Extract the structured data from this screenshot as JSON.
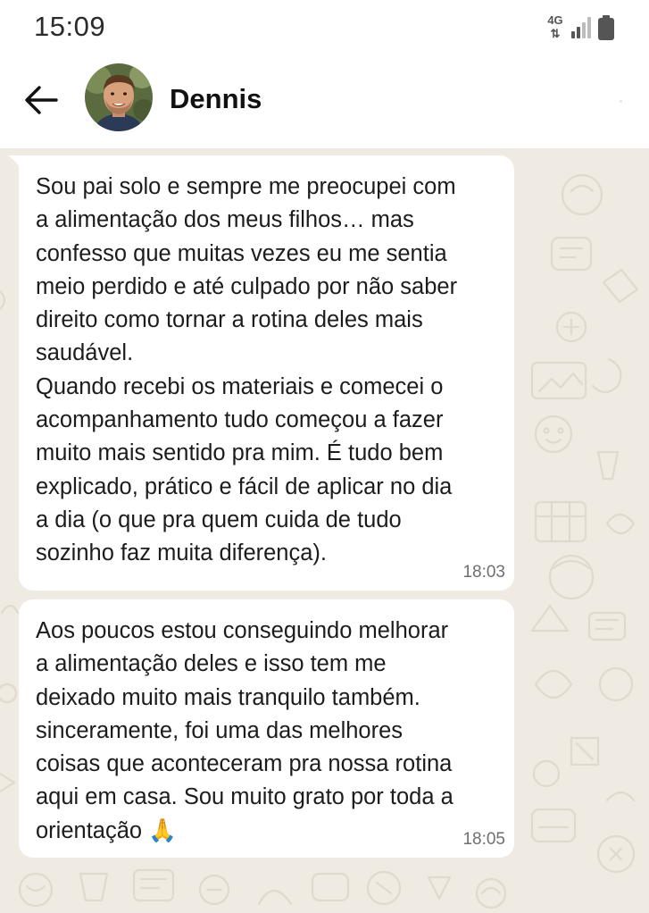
{
  "status_bar": {
    "time": "15:09",
    "network_label": "4G",
    "network_icon": "data-arrows-icon",
    "signal_icon": "signal-bars-icon",
    "battery_icon": "battery-icon"
  },
  "header": {
    "back_icon": "arrow-left-icon",
    "avatar_icon": "contact-avatar",
    "contact_name": "Dennis"
  },
  "messages": [
    {
      "text": "Sou pai solo e sempre me preocupei com\na alimentação dos meus filhos… mas\nconfesso que muitas vezes eu me sentia\nmeio perdido e até culpado por não saber\ndireito como tornar a rotina deles mais\nsaudável.\nQuando recebi os materiais e comecei o\nacompanhamento tudo começou a fazer\nmuito mais sentido pra mim. É tudo bem\nexplicado, prático e fácil de aplicar no dia\na dia (o que pra quem cuida de tudo\nsozinho faz muita diferença).",
      "time": "18:03"
    },
    {
      "text": "Aos poucos estou conseguindo melhorar\na alimentação deles e isso tem me\ndeixado muito mais tranquilo também.\nsinceramente, foi uma das melhores\ncoisas que aconteceram pra nossa rotina\naqui em casa. Sou muito grato por toda a\norientação 🙏",
      "time": "18:05"
    }
  ],
  "colors": {
    "chat_background": "#efeae2",
    "bubble_background": "#ffffff",
    "text": "#1c1c1c",
    "timestamp": "#6f6f6f"
  }
}
